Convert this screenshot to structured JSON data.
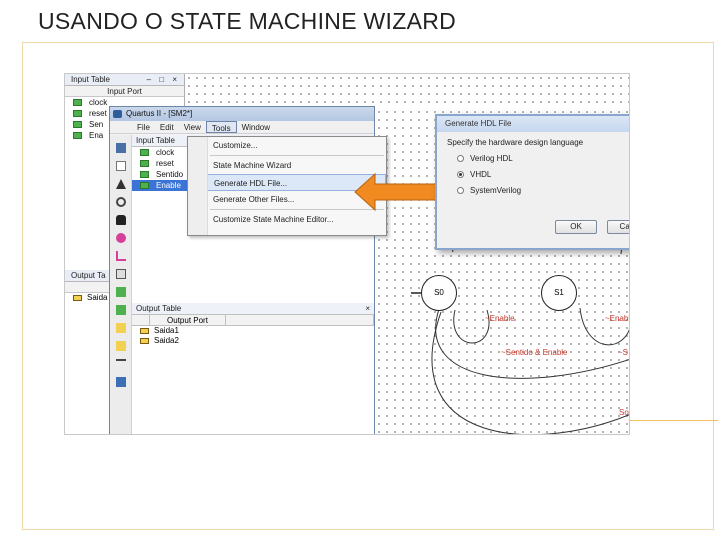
{
  "slide": {
    "title": "USANDO O STATE MACHINE WIZARD"
  },
  "back_window": {
    "title": "Input Table",
    "column_header": "Input Port",
    "rows": [
      "clock",
      "reset",
      "Sen",
      "Ena"
    ],
    "output_title": "Output Ta",
    "output_col": "Ou",
    "output_rows": [
      "Saida"
    ]
  },
  "quartus": {
    "title": "Quartus II - [SM2*]",
    "menubar": [
      "File",
      "Edit",
      "View",
      "Tools",
      "Window"
    ],
    "input_panel_title": "Input Table",
    "input_rows": [
      "clock",
      "reset",
      "Sentido",
      "Enable"
    ],
    "output_panel_title": "Output Table",
    "output_col_header": "Output Port",
    "output_rows": [
      "Saida1",
      "Saida2"
    ]
  },
  "tools_menu": {
    "items": [
      "Customize...",
      "State Machine Wizard",
      "Generate HDL File...",
      "Generate Other Files...",
      "Customize State Machine Editor..."
    ],
    "highlighted_index": 2
  },
  "dialog": {
    "title": "Generate HDL File",
    "prompt": "Specify the hardware design language",
    "options": [
      "Verilog HDL",
      "VHDL",
      "SystemVerilog"
    ],
    "selected_index": 1,
    "ok_label": "OK",
    "cancel_label": "Cancel",
    "close_label": "x"
  },
  "diagram": {
    "states": [
      "S0",
      "S1"
    ],
    "transitions": [
      "~Enable",
      "~Enable",
      "~Sentido & Enable",
      "~S",
      "So"
    ]
  },
  "colors": {
    "arrow_fill": "#f18a21",
    "transition_text": "#c0382b",
    "selected_row": "#3b73d6"
  }
}
